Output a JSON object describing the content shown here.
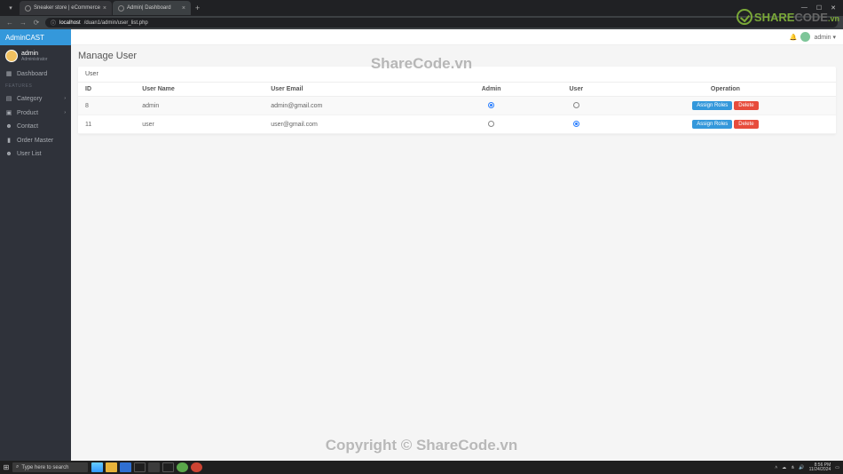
{
  "browser": {
    "tabs": [
      {
        "title": "Sneaker store | eCommerce"
      },
      {
        "title": "Admin| Dashboard"
      }
    ],
    "url_host": "localhost",
    "url_path": "/duan1/admin/user_list.php"
  },
  "brand": "AdminCAST",
  "sidebar_user": {
    "name": "admin",
    "role": "Administrator"
  },
  "nav": {
    "dashboard": "Dashboard",
    "features": "FEATURES",
    "category": "Category",
    "product": "Product",
    "contact": "Contact",
    "order_master": "Order Master",
    "user_list": "User List"
  },
  "topbar_user": "admin",
  "page_title": "Manage User",
  "card_title": "User",
  "columns": {
    "id": "ID",
    "name": "User Name",
    "email": "User Email",
    "admin": "Admin",
    "user": "User",
    "op": "Operation"
  },
  "rows": [
    {
      "id": "8",
      "name": "admin",
      "email": "admin@gmail.com",
      "admin": true,
      "user": false
    },
    {
      "id": "11",
      "name": "user",
      "email": "user@gmail.com",
      "admin": false,
      "user": true
    }
  ],
  "buttons": {
    "assign": "Assign Roles",
    "delete": "Delete"
  },
  "watermark1": "ShareCode.vn",
  "watermark2": "Copyright © ShareCode.vn",
  "logo": {
    "a": "SHARE",
    "b": "CODE",
    "c": ".vn"
  },
  "taskbar": {
    "search": "Type here to search",
    "time": "8:56 PM",
    "date": "11/24/2024"
  }
}
